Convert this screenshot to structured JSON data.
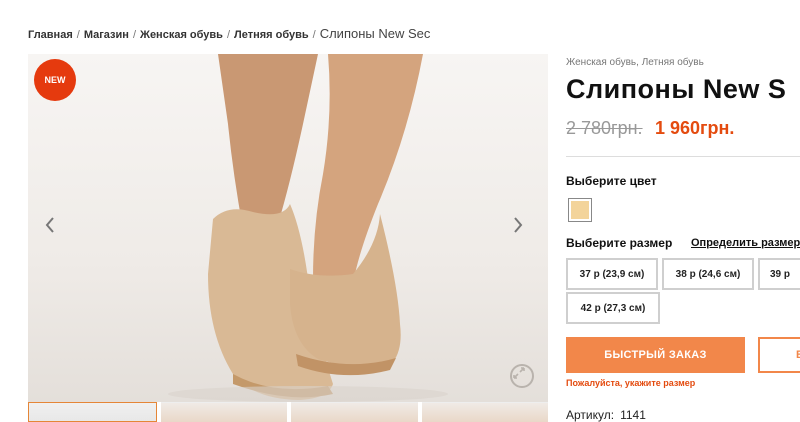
{
  "breadcrumb": {
    "items": [
      "Главная",
      "Магазин",
      "Женская обувь",
      "Летняя обувь"
    ],
    "separator": "/",
    "current": "Слипоны New Sec"
  },
  "gallery": {
    "badge": "NEW",
    "badge_color": "#e53a0e",
    "prev_icon": "chevron-left-icon",
    "next_icon": "chevron-right-icon",
    "zoom_icon": "zoom-icon",
    "thumbnail_count": 4
  },
  "product": {
    "categories": "Женская обувь, Летняя обувь",
    "title": "Слипоны New S",
    "old_price": "2 780грн.",
    "new_price": "1 960грн.",
    "price_color": "#e44b0f",
    "color_label": "Выберите цвет",
    "color_swatch": "#f3d49b",
    "size_label": "Выберите размер",
    "size_guide": "Определить размер",
    "sizes": [
      "37 р (23,9 см)",
      "38 р (24,6 см)",
      "39 р",
      "42 р (27,3 см)"
    ],
    "quick_order": "БЫСТРЫЙ ЗАКАЗ",
    "second_button": "В",
    "button_color": "#f2874a",
    "error": "Пожалуйста, укажите размер",
    "sku_label": "Артикул:",
    "sku_value": "1141"
  }
}
